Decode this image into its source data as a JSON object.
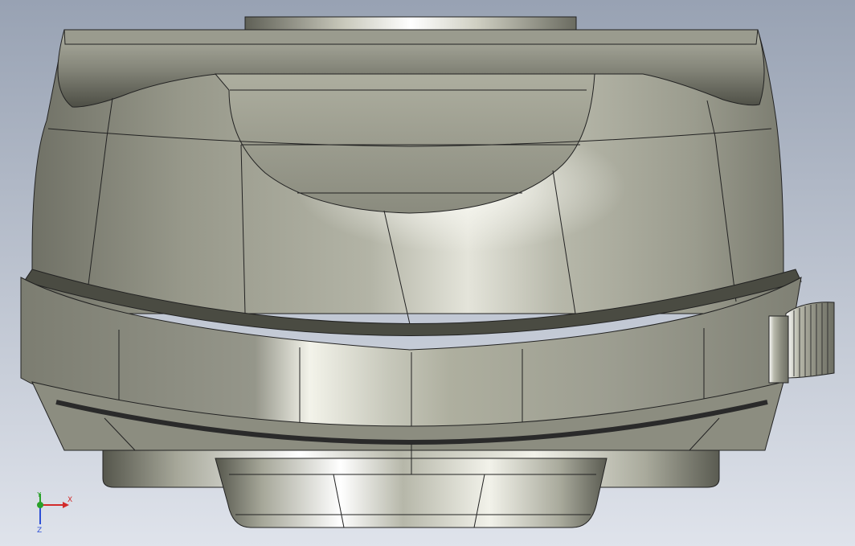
{
  "viewport": {
    "background_top": "#9aa3b4",
    "background_bottom": "#dde2ea"
  },
  "model": {
    "part": "cylindrical-housing-with-band-clamp",
    "metal_dark": "#6e6f63",
    "metal_mid": "#a3a496",
    "metal_light": "#d4d5c8",
    "metal_highlight": "#f4f4ec",
    "edge_color": "#1a1a1a"
  },
  "triad": {
    "x_label": "X",
    "y_label": "Y",
    "z_label": "Z",
    "x_color": "#d22b2b",
    "y_color": "#2aa12a",
    "z_color": "#2d4fd6"
  }
}
